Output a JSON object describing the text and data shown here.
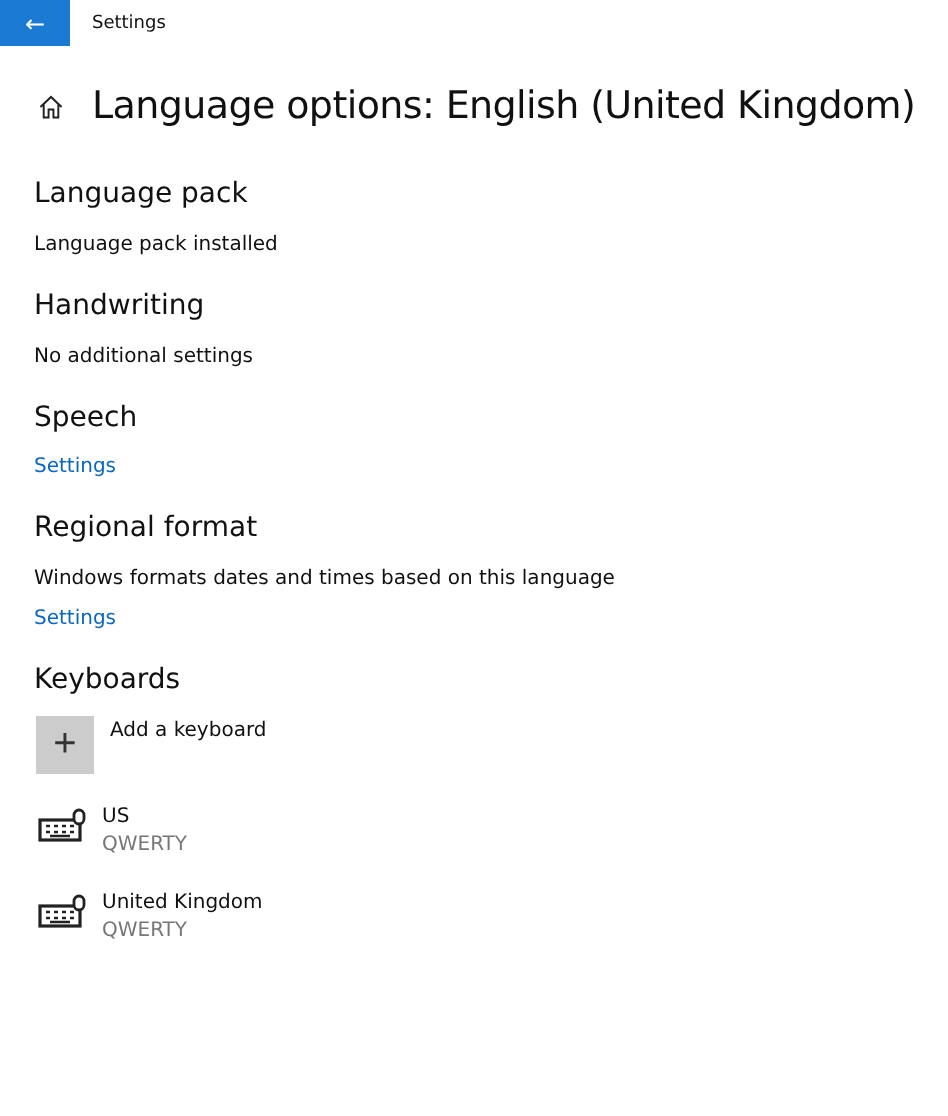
{
  "window": {
    "title": "Settings",
    "back_button": "←"
  },
  "heading": "Language options: English (United Kingdom)",
  "sections": [
    {
      "title": "Language pack",
      "lines": [
        {
          "kind": "text",
          "text": "Language pack installed"
        }
      ]
    },
    {
      "title": "Handwriting",
      "lines": [
        {
          "kind": "text",
          "text": "No additional settings"
        }
      ]
    },
    {
      "title": "Speech",
      "lines": [
        {
          "kind": "link",
          "text": "Settings"
        }
      ]
    },
    {
      "title": "Regional format",
      "lines": [
        {
          "kind": "text",
          "text": "Windows formats dates and times based on this language"
        },
        {
          "kind": "link",
          "text": "Settings"
        }
      ]
    }
  ],
  "keyboards": {
    "title": "Keyboards",
    "add_label": "Add a keyboard",
    "add_icon": "+",
    "items": [
      {
        "name": "US",
        "layout": "QWERTY"
      },
      {
        "name": "United Kingdom",
        "layout": "QWERTY"
      }
    ]
  }
}
